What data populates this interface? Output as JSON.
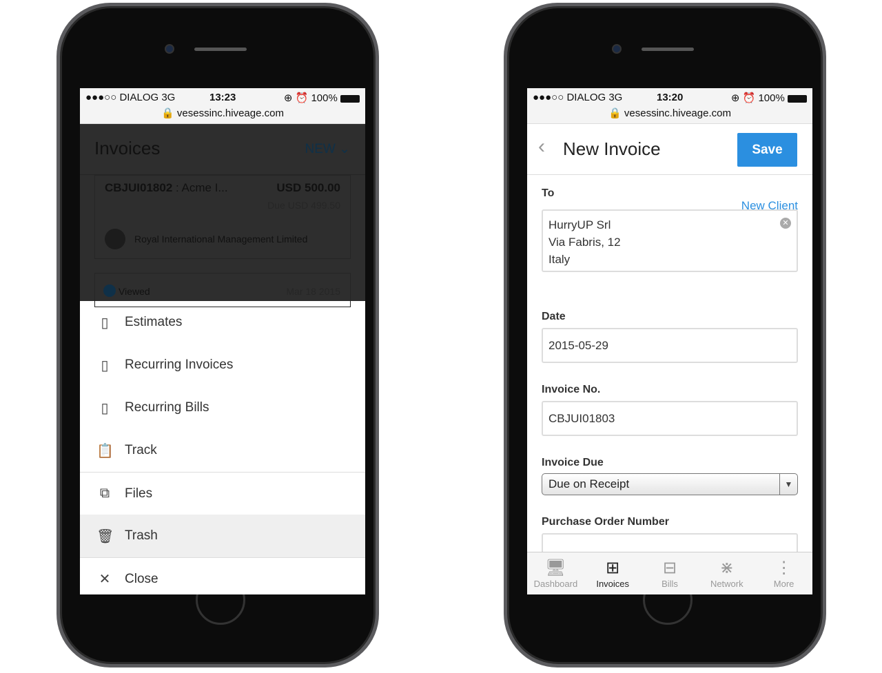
{
  "left": {
    "status": {
      "carrier": "●●●○○ DIALOG  3G",
      "time": "13:23",
      "battery": "100%",
      "url": "vesessinc.hiveage.com"
    },
    "header": {
      "title": "Invoices",
      "new_label": "NEW"
    },
    "invoice": {
      "id": "CBJUI01802",
      "client_short": ": Acme I...",
      "amount": "USD 500.00",
      "due": "Due USD 499.50",
      "contact": "Royal International Management Limited"
    },
    "invoice2": {
      "status": "Viewed",
      "date": "Mar 18 2015"
    },
    "menu": [
      {
        "label": "Estimates",
        "icon": "estimate-icon"
      },
      {
        "label": "Recurring Invoices",
        "icon": "recurring-invoice-icon"
      },
      {
        "label": "Recurring Bills",
        "icon": "recurring-bill-icon"
      },
      {
        "label": "Track",
        "icon": "track-icon"
      },
      {
        "label": "Files",
        "icon": "files-icon"
      },
      {
        "label": "Trash",
        "icon": "trash-icon"
      },
      {
        "label": "Close",
        "icon": "close-icon"
      }
    ]
  },
  "right": {
    "status": {
      "carrier": "●●●○○ DIALOG  3G",
      "time": "13:20",
      "battery": "100%",
      "url": "vesessinc.hiveage.com"
    },
    "header": {
      "title": "New Invoice",
      "save": "Save"
    },
    "form": {
      "to_label": "To",
      "new_client": "New Client",
      "to_lines": [
        "HurryUP Srl",
        "Via Fabris, 12",
        "Italy"
      ],
      "date_label": "Date",
      "date": "2015-05-29",
      "invno_label": "Invoice No.",
      "invno": "CBJUI01803",
      "due_label": "Invoice Due",
      "due": "Due on Receipt",
      "po_label": "Purchase Order Number"
    },
    "tabs": [
      {
        "label": "Dashboard",
        "icon": "dashboard-icon"
      },
      {
        "label": "Invoices",
        "icon": "invoices-icon"
      },
      {
        "label": "Bills",
        "icon": "bills-icon"
      },
      {
        "label": "Network",
        "icon": "network-icon"
      },
      {
        "label": "More",
        "icon": "more-icon"
      }
    ]
  },
  "colors": {
    "accent": "#2b8fe0"
  }
}
